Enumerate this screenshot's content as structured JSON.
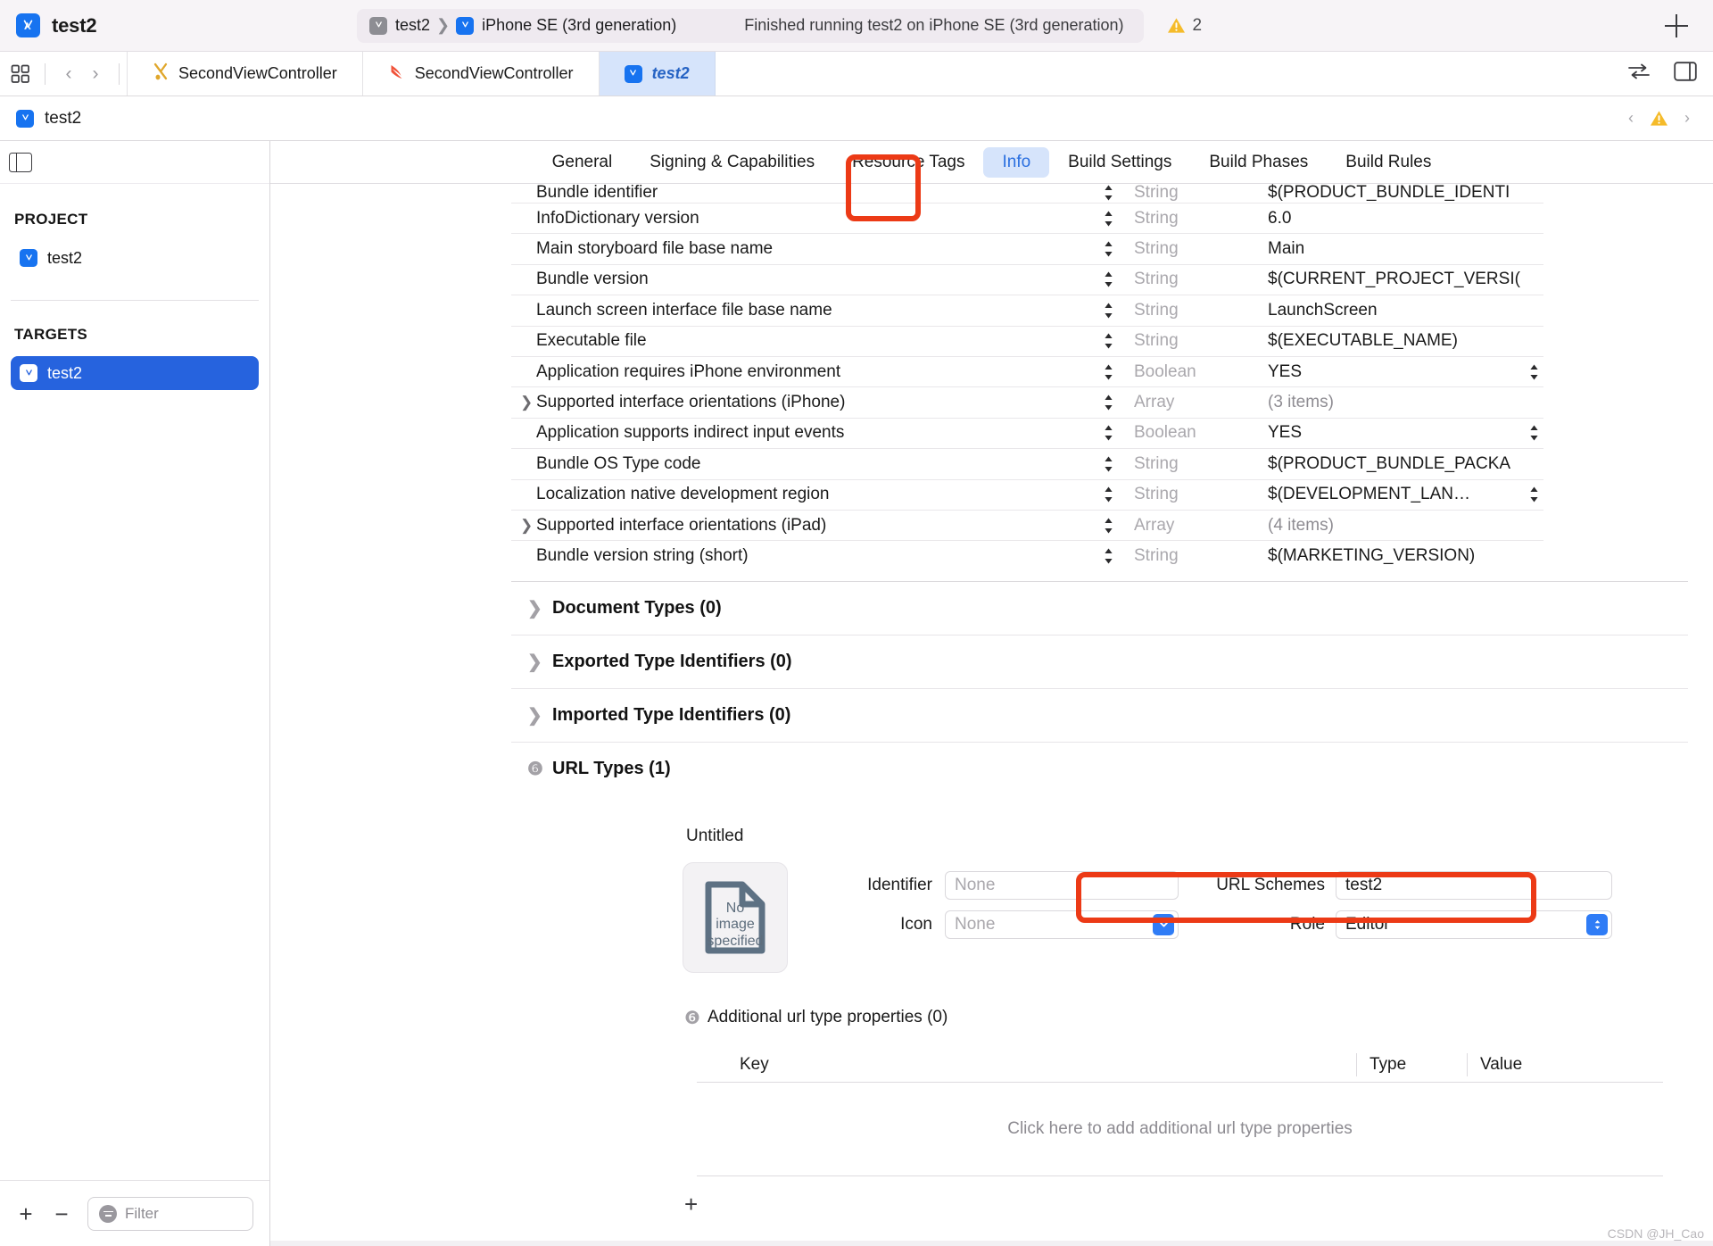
{
  "toolbar": {
    "project_name": "test2",
    "scheme": "test2",
    "destination": "iPhone SE (3rd generation)",
    "status": "Finished running test2 on iPhone SE (3rd generation)",
    "warning_count": "2",
    "add_label": "+",
    "icons": {
      "app_icon": "appstore-icon",
      "warning": "warning-triangle-icon",
      "add": "plus-icon"
    }
  },
  "editor_tabs": {
    "grid_icon": "grid-icon",
    "back_arrow": "‹",
    "forward_arrow": "›",
    "items": [
      {
        "label": "SecondViewController",
        "icon": "header-file-icon",
        "active": false
      },
      {
        "label": "SecondViewController",
        "icon": "swift-file-icon",
        "active": false
      },
      {
        "label": "test2",
        "icon": "project-icon",
        "active": true
      }
    ],
    "right_icons": [
      "compare-versions-icon",
      "inspector-toggle-icon"
    ]
  },
  "breadcrumb": {
    "label": "test2",
    "icon": "project-icon",
    "prev": "‹",
    "next": "›",
    "warning_icon": "warning-triangle-icon"
  },
  "sidebar": {
    "panel_toggle_icon": "left-panel-toggle-icon",
    "project_header": "PROJECT",
    "project_items": [
      {
        "label": "test2",
        "icon": "project-icon"
      }
    ],
    "targets_header": "TARGETS",
    "target_items": [
      {
        "label": "test2",
        "icon": "project-icon",
        "selected": true
      }
    ],
    "footer": {
      "add_label": "+",
      "remove_label": "−",
      "filter_placeholder": "Filter",
      "filter_icon": "filter-icon"
    }
  },
  "main_tabs": {
    "items": [
      {
        "label": "General",
        "active": false
      },
      {
        "label": "Signing & Capabilities",
        "active": false
      },
      {
        "label": "Resource Tags",
        "active": false
      },
      {
        "label": "Info",
        "active": true
      },
      {
        "label": "Build Settings",
        "active": false
      },
      {
        "label": "Build Phases",
        "active": false
      },
      {
        "label": "Build Rules",
        "active": false
      }
    ]
  },
  "plist": {
    "rows": [
      {
        "key": "Bundle identifier",
        "type": "String",
        "value": "$(PRODUCT_BUNDLE_IDENTI",
        "expandable": false,
        "stepper_on_value": false,
        "clipped_top": true
      },
      {
        "key": "InfoDictionary version",
        "type": "String",
        "value": "6.0",
        "expandable": false,
        "stepper_on_value": false
      },
      {
        "key": "Main storyboard file base name",
        "type": "String",
        "value": "Main",
        "expandable": false,
        "stepper_on_value": false
      },
      {
        "key": "Bundle version",
        "type": "String",
        "value": "$(CURRENT_PROJECT_VERSI(",
        "expandable": false,
        "stepper_on_value": false
      },
      {
        "key": "Launch screen interface file base name",
        "type": "String",
        "value": "LaunchScreen",
        "expandable": false,
        "stepper_on_value": false
      },
      {
        "key": "Executable file",
        "type": "String",
        "value": "$(EXECUTABLE_NAME)",
        "expandable": false,
        "stepper_on_value": false
      },
      {
        "key": "Application requires iPhone environment",
        "type": "Boolean",
        "value": "YES",
        "expandable": false,
        "stepper_on_value": true
      },
      {
        "key": "Supported interface orientations (iPhone)",
        "type": "Array",
        "value": "(3 items)",
        "expandable": true,
        "muted_value": true,
        "stepper_on_value": false
      },
      {
        "key": "Application supports indirect input events",
        "type": "Boolean",
        "value": "YES",
        "expandable": false,
        "stepper_on_value": true
      },
      {
        "key": "Bundle OS Type code",
        "type": "String",
        "value": "$(PRODUCT_BUNDLE_PACKA",
        "expandable": false,
        "stepper_on_value": false
      },
      {
        "key": "Localization native development region",
        "type": "String",
        "value": "$(DEVELOPMENT_LAN…",
        "expandable": false,
        "stepper_on_value": true
      },
      {
        "key": "Supported interface orientations (iPad)",
        "type": "Array",
        "value": "(4 items)",
        "expandable": true,
        "muted_value": true,
        "stepper_on_value": false
      },
      {
        "key": "Bundle version string (short)",
        "type": "String",
        "value": "$(MARKETING_VERSION)",
        "expandable": false,
        "stepper_on_value": false
      }
    ]
  },
  "sections": [
    {
      "label": "Document Types (0)",
      "expanded": false
    },
    {
      "label": "Exported Type Identifiers (0)",
      "expanded": false
    },
    {
      "label": "Imported Type Identifiers (0)",
      "expanded": false
    },
    {
      "label": "URL Types (1)",
      "expanded": true
    }
  ],
  "url_type": {
    "title": "Untitled",
    "image_well": {
      "line1": "No",
      "line2": "image",
      "line3": "specified",
      "icon": "document-placeholder-icon"
    },
    "identifier_label": "Identifier",
    "identifier_placeholder": "None",
    "identifier_value": "",
    "icon_label": "Icon",
    "icon_placeholder": "None",
    "icon_value": "",
    "url_schemes_label": "URL Schemes",
    "url_schemes_value": "test2",
    "role_label": "Role",
    "role_value": "Editor",
    "additional": {
      "header": "Additional url type properties (0)",
      "columns": [
        "Key",
        "Type",
        "Value"
      ],
      "rows": [],
      "empty_hint": "Click here to add additional url type properties",
      "add_label": "+"
    }
  },
  "watermark": "CSDN @JH_Cao",
  "colors": {
    "accent_blue": "#2663de",
    "tab_active_bg": "#d6e4fb",
    "tab_active_text": "#2a6fe0",
    "annotation_red": "#ec3a16",
    "warning_yellow": "#f5bb2a"
  }
}
